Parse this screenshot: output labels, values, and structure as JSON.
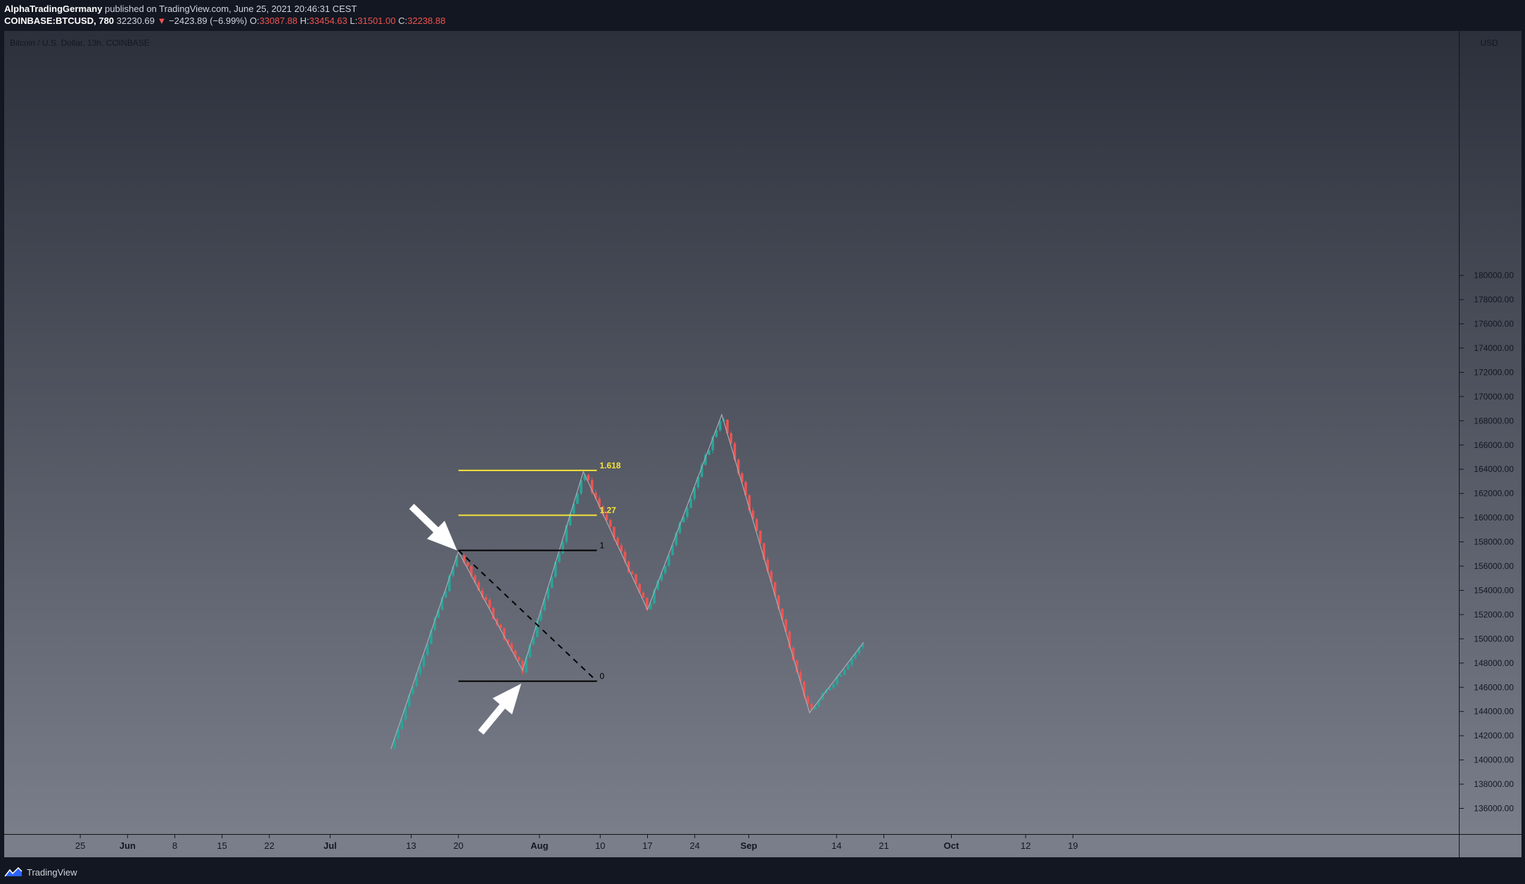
{
  "header": {
    "author": "AlphaTradingGermany",
    "published": "published on TradingView.com, June 25, 2021 20:46:31 CEST",
    "ticker": "COINBASE:BTCUSD, 780",
    "price": "32230.69",
    "change": "−2423.89 (−6.99%)",
    "open_label": "O:",
    "open": "33087.88",
    "high_label": "H:",
    "high": "33454.63",
    "low_label": "L:",
    "low": "31501.00",
    "close_label": "C:",
    "close": "32238.88"
  },
  "footer": {
    "brand": "TradingView"
  },
  "colors": {
    "background_top": "#2b303b",
    "background_bottom": "#7a7e8a",
    "bull": "#26a69a",
    "bear": "#ef5350",
    "fib_gold": "#f5e33a",
    "fib_black": "#000000"
  },
  "chart_data": {
    "type": "candlestick",
    "title": "Bitcoin / U.S. Dollar, 13h, COINBASE",
    "y_unit": "USD",
    "y_axis": {
      "min": 134000,
      "max": 181000,
      "ticks": [
        136000,
        138000,
        140000,
        142000,
        144000,
        146000,
        148000,
        150000,
        152000,
        154000,
        156000,
        158000,
        160000,
        162000,
        164000,
        166000,
        168000,
        170000,
        172000,
        174000,
        176000,
        178000,
        180000
      ]
    },
    "x_axis": {
      "labels": [
        "25",
        "Jun",
        "8",
        "15",
        "22",
        "Jul",
        "13",
        "20",
        "Aug",
        "10",
        "17",
        "24",
        "Sep",
        "14",
        "21",
        "Oct",
        "12",
        "19"
      ],
      "label_days": [
        -7,
        0,
        7,
        14,
        21,
        30,
        42,
        49,
        61,
        70,
        77,
        84,
        92,
        105,
        112,
        122,
        133,
        140
      ]
    },
    "zigzag": [
      {
        "day": 39.0,
        "price": 140900
      },
      {
        "day": 49.0,
        "price": 157200
      },
      {
        "day": 58.5,
        "price": 147400
      },
      {
        "day": 67.5,
        "price": 163800
      },
      {
        "day": 77.0,
        "price": 152400
      },
      {
        "day": 88.0,
        "price": 168500
      },
      {
        "day": 101.0,
        "price": 143900
      },
      {
        "day": 109.0,
        "price": 149700
      }
    ],
    "fibonacci": {
      "start_day": 49.0,
      "end_day": 69.5,
      "levels": [
        {
          "label": "1.618",
          "price": 163900
        },
        {
          "label": "1.27",
          "price": 160200
        },
        {
          "label": "1",
          "price": 157300
        },
        {
          "label": "0",
          "price": 146500
        }
      ],
      "trend_from": {
        "day": 49.0,
        "price": 157300
      },
      "trend_to": {
        "day": 69.5,
        "price": 146500
      }
    },
    "arrows": [
      {
        "tip_day": 48.8,
        "tip_price": 157300,
        "from": "upper-left"
      },
      {
        "tip_day": 58.3,
        "tip_price": 146300,
        "from": "lower-left"
      }
    ]
  }
}
